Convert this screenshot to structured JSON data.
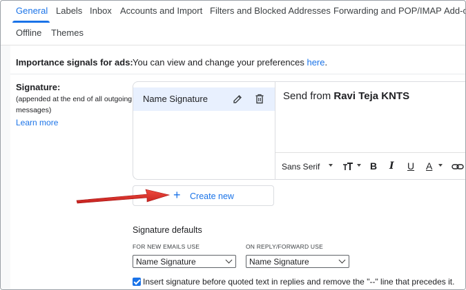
{
  "tabs": {
    "row1": [
      "General",
      "Labels",
      "Inbox",
      "Accounts and Import",
      "Filters and Blocked Addresses",
      "Forwarding and POP/IMAP",
      "Add-o"
    ],
    "row2": [
      "Offline",
      "Themes"
    ],
    "active": "General",
    "accent_color": "#1a73e8"
  },
  "importance": {
    "label": "Importance signals for ads:",
    "text": "You can view and change your preferences ",
    "link": "here",
    "after": "."
  },
  "signature": {
    "label": "Signature:",
    "sublabel": "(appended at the end of all outgoing messages)",
    "learn_more": "Learn more",
    "list": [
      {
        "name": "Name Signature",
        "icons": [
          "pencil-icon",
          "trash-icon"
        ]
      }
    ],
    "editor": {
      "text_plain": "Send from ",
      "text_bold": "Ravi Teja KNTS"
    },
    "toolbar": {
      "font": "Sans Serif",
      "size_icon": "text-size-icon",
      "bold": "B",
      "italic": "I",
      "underline": "U",
      "color": "A",
      "link_icon": "link-icon"
    },
    "create_new": "Create new"
  },
  "defaults": {
    "title": "Signature defaults",
    "new_emails_label": "FOR NEW EMAILS USE",
    "new_emails_value": "Name Signature",
    "reply_label": "ON REPLY/FORWARD USE",
    "reply_value": "Name Signature"
  },
  "insert_before_quoted": {
    "checked": true,
    "label": "Insert signature before quoted text in replies and remove the \"--\" line that precedes it."
  },
  "annotation": {
    "arrow_color": "#d93025"
  }
}
